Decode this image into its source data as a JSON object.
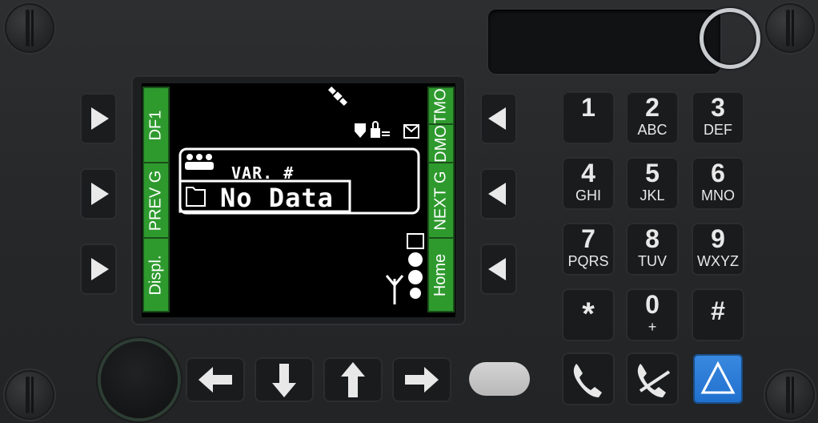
{
  "device": {
    "softkeys_left": [
      "DF1",
      "PREV G",
      "Displ."
    ],
    "softkeys_right": [
      "TMO",
      "DMO",
      "NEXT G",
      "Home"
    ]
  },
  "screen": {
    "header": "VAR. #",
    "message": "No Data"
  },
  "keypad": [
    {
      "digit": "1",
      "letters": ""
    },
    {
      "digit": "2",
      "letters": "ABC"
    },
    {
      "digit": "3",
      "letters": "DEF"
    },
    {
      "digit": "4",
      "letters": "GHI"
    },
    {
      "digit": "5",
      "letters": "JKL"
    },
    {
      "digit": "6",
      "letters": "MNO"
    },
    {
      "digit": "7",
      "letters": "PQRS"
    },
    {
      "digit": "8",
      "letters": "TUV"
    },
    {
      "digit": "9",
      "letters": "WXYZ"
    },
    {
      "digit": "*",
      "letters": ""
    },
    {
      "digit": "0",
      "letters": "+"
    },
    {
      "digit": "#",
      "letters": ""
    }
  ],
  "colors": {
    "softkey_green": "#2e9a2e",
    "accent_blue": "#1f6fce"
  },
  "icons": [
    "satellite-icon",
    "shield-icon",
    "lock-icon",
    "envelope-icon",
    "group-icon",
    "folder-icon",
    "antenna-icon",
    "signal-bars-icon",
    "left-arrow-icon",
    "down-arrow-icon",
    "up-arrow-icon",
    "right-arrow-icon",
    "call-answer-icon",
    "call-end-icon",
    "triangle-icon"
  ]
}
